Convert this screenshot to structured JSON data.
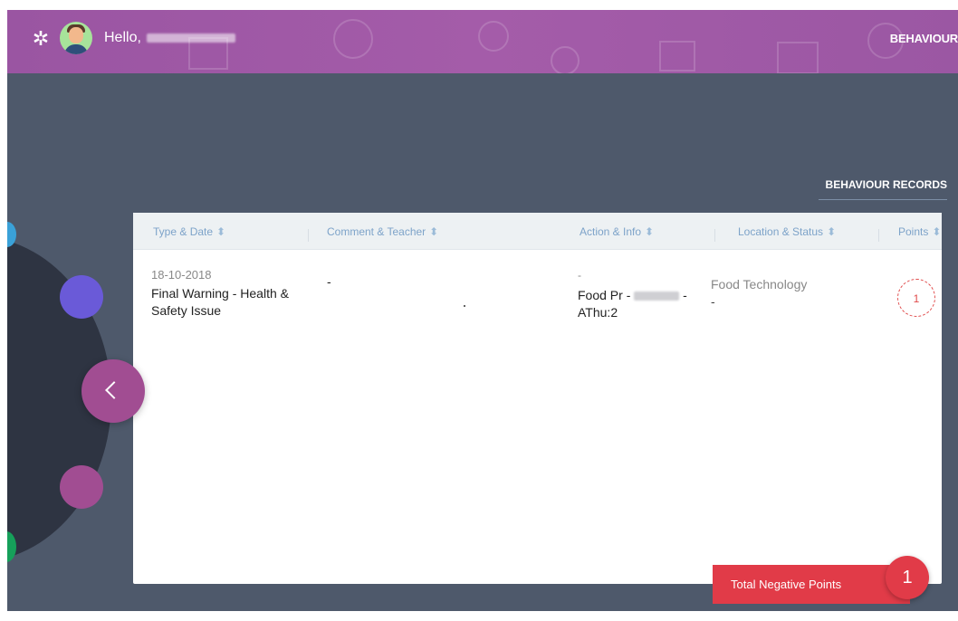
{
  "header": {
    "greeting": "Hello,",
    "top_right_label": "BEHAVIOUR"
  },
  "section": {
    "title": "BEHAVIOUR RECORDS"
  },
  "table": {
    "columns": [
      {
        "label": "Type & Date"
      },
      {
        "label": "Comment & Teacher"
      },
      {
        "label": "Action & Info"
      },
      {
        "label": "Location & Status"
      },
      {
        "label": "Points"
      }
    ],
    "sort_glyph": "⬍",
    "rows": [
      {
        "date": "18-10-2018",
        "type": "Final Warning - Health & Safety Issue",
        "comment": "-",
        "action_dash": "-",
        "action_prefix": "Food Pr -",
        "action_suffix": "-",
        "action_line2": "AThu:2",
        "location": "Food Technology",
        "status": "-",
        "points": "1"
      }
    ]
  },
  "summary": {
    "label": "Total Negative Points",
    "value": "1"
  },
  "icons": {
    "settings": "gear-icon",
    "prev": "chevron-left-icon"
  },
  "colors": {
    "header_purple": "#a45ca9",
    "background": "#4e596b",
    "accent_red": "#e13b48",
    "nav_purple": "#a14d92"
  }
}
